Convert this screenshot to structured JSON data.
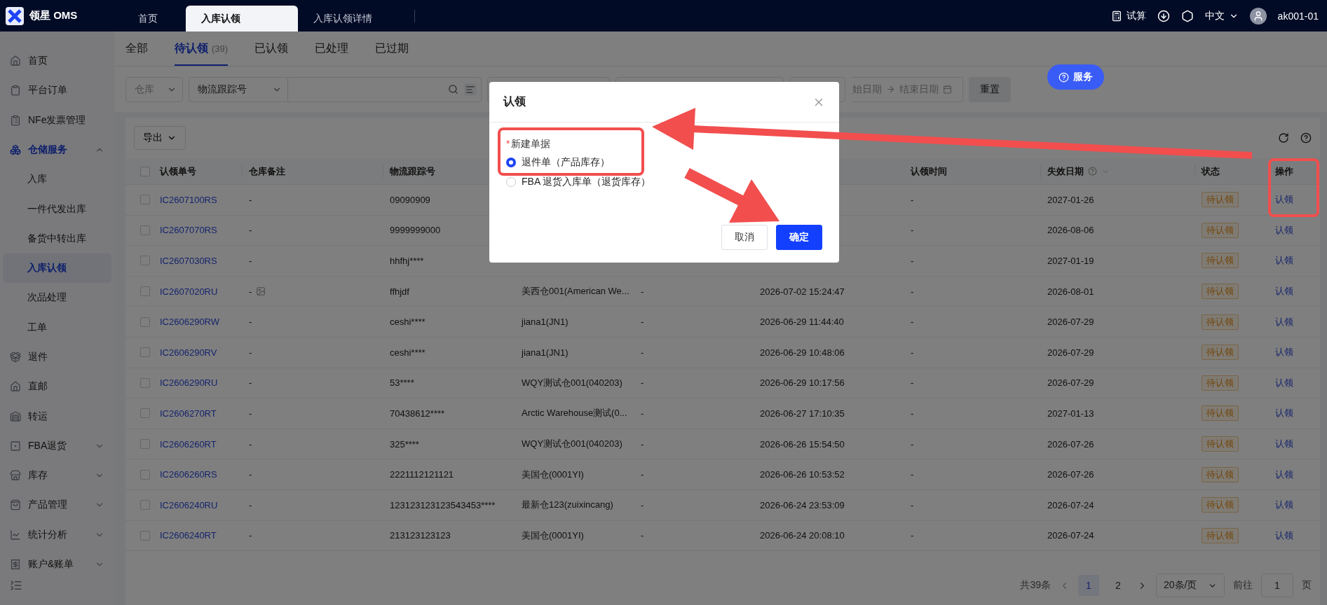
{
  "top_bar": {
    "logo_text": "领星 OMS",
    "tabs": [
      {
        "label": "首页",
        "selected": false
      },
      {
        "label": "入库认领",
        "selected": true
      },
      {
        "label": "入库认领详情",
        "selected": false
      }
    ],
    "trial_calc": "试算",
    "language": "中文",
    "user": "ak001-01"
  },
  "sidebar": {
    "items": [
      {
        "label": "首页",
        "kind": "link",
        "selected": false
      },
      {
        "label": "平台订单",
        "kind": "link",
        "selected": false
      },
      {
        "label": "NFe发票管理",
        "kind": "link",
        "selected": false
      },
      {
        "label": "仓储服务",
        "kind": "group",
        "selected": true,
        "expanded": true,
        "children": [
          {
            "label": "入库",
            "selected": false
          },
          {
            "label": "一件代发出库",
            "selected": false
          },
          {
            "label": "备货中转出库",
            "selected": false
          },
          {
            "label": "入库认领",
            "selected": true
          },
          {
            "label": "次品处理",
            "selected": false
          },
          {
            "label": "工单",
            "selected": false
          }
        ]
      },
      {
        "label": "退件",
        "kind": "link",
        "selected": false
      },
      {
        "label": "直邮",
        "kind": "link",
        "selected": false
      },
      {
        "label": "转运",
        "kind": "link",
        "selected": false
      },
      {
        "label": "FBA退货",
        "kind": "group",
        "selected": false,
        "expanded": false
      },
      {
        "label": "库存",
        "kind": "group",
        "selected": false,
        "expanded": false
      },
      {
        "label": "产品管理",
        "kind": "group",
        "selected": false,
        "expanded": false
      },
      {
        "label": "统计分析",
        "kind": "group",
        "selected": false,
        "expanded": false
      },
      {
        "label": "账户&账单",
        "kind": "group",
        "selected": false,
        "expanded": false
      }
    ]
  },
  "page_tabs": [
    {
      "label": "全部",
      "selected": false
    },
    {
      "label": "待认领",
      "count": "(39)",
      "selected": true
    },
    {
      "label": "已认领",
      "selected": false
    },
    {
      "label": "已处理",
      "selected": false
    },
    {
      "label": "已过期",
      "selected": false
    }
  ],
  "filters": {
    "warehouse_select": "仓库",
    "search_type_select": "物流跟踪号",
    "date_start": "始日期",
    "date_end": "结束日期",
    "reset_button": "重置"
  },
  "service_button": "服务",
  "toolbar": {
    "export_button": "导出"
  },
  "table": {
    "select_all_checked": false,
    "headers": {
      "claim_no": "认领单号",
      "remark": "仓库备注",
      "tracking_no": "物流跟踪号",
      "claim_time": "认领时间",
      "expiry_date": "失效日期",
      "status": "状态",
      "actions": "操作"
    },
    "rows": [
      {
        "checked": false,
        "claim_no": "IC2607100RS",
        "remark": "-",
        "image": false,
        "tracking_no": "09090909",
        "claim_time": "-",
        "expiry_date": "2027-01-26",
        "status": "待认领",
        "action": "认领"
      },
      {
        "checked": false,
        "claim_no": "IC2607070RS",
        "remark": "-",
        "image": false,
        "tracking_no": "9999999000",
        "claim_time": "-",
        "expiry_date": "2026-08-06",
        "status": "待认领",
        "action": "认领"
      },
      {
        "checked": false,
        "claim_no": "IC2607030RS",
        "remark": "-",
        "image": false,
        "tracking_no": "hhfhj****",
        "claim_time": "-",
        "expiry_date": "2027-01-19",
        "status": "待认领",
        "action": "认领"
      },
      {
        "checked": false,
        "claim_no": "IC2607020RU",
        "remark": "-",
        "image": true,
        "tracking_no": "ffhjdf",
        "column_4": "美西仓001(American We...",
        "column_5": "-",
        "column_6": "2026-07-02 15:24:47",
        "claim_time": "-",
        "expiry_date": "2026-08-01",
        "status": "待认领",
        "action": "认领"
      },
      {
        "checked": false,
        "claim_no": "IC2606290RW",
        "remark": "-",
        "image": false,
        "tracking_no": "ceshi****",
        "column_4": "jiana1(JN1)",
        "column_5": "-",
        "column_6": "2026-06-29 11:44:40",
        "claim_time": "-",
        "expiry_date": "2026-07-29",
        "status": "待认领",
        "action": "认领"
      },
      {
        "checked": false,
        "claim_no": "IC2606290RV",
        "remark": "-",
        "image": false,
        "tracking_no": "ceshi****",
        "column_4": "jiana1(JN1)",
        "column_5": "-",
        "column_6": "2026-06-29 10:48:06",
        "claim_time": "-",
        "expiry_date": "2026-07-29",
        "status": "待认领",
        "action": "认领"
      },
      {
        "checked": false,
        "claim_no": "IC2606290RU",
        "remark": "-",
        "image": false,
        "tracking_no": "53****",
        "column_4": "WQY测试仓001(040203)",
        "column_5": "-",
        "column_6": "2026-06-29 10:17:56",
        "claim_time": "-",
        "expiry_date": "2026-07-29",
        "status": "待认领",
        "action": "认领"
      },
      {
        "checked": false,
        "claim_no": "IC2606270RT",
        "remark": "-",
        "image": false,
        "tracking_no": "70438612****",
        "column_4": "Arctic Warehouse测试(0...",
        "column_5": "-",
        "column_6": "2026-06-27 17:10:35",
        "claim_time": "-",
        "expiry_date": "2027-01-13",
        "status": "待认领",
        "action": "认领"
      },
      {
        "checked": false,
        "claim_no": "IC2606260RT",
        "remark": "-",
        "image": false,
        "tracking_no": "325****",
        "column_4": "WQY测试仓001(040203)",
        "column_5": "-",
        "column_6": "2026-06-26 15:54:50",
        "claim_time": "-",
        "expiry_date": "2026-07-26",
        "status": "待认领",
        "action": "认领"
      },
      {
        "checked": false,
        "claim_no": "IC2606260RS",
        "remark": "-",
        "image": false,
        "tracking_no": "2221112121121",
        "column_4": "美国仓(0001YI)",
        "column_5": "-",
        "column_6": "2026-06-26 10:53:52",
        "claim_time": "-",
        "expiry_date": "2026-07-26",
        "status": "待认领",
        "action": "认领"
      },
      {
        "checked": false,
        "claim_no": "IC2606240RU",
        "remark": "-",
        "image": false,
        "tracking_no": "123123123123543453****",
        "column_4": "最新仓123(zuixincang)",
        "column_5": "-",
        "column_6": "2026-06-24 23:53:09",
        "claim_time": "-",
        "expiry_date": "2026-07-24",
        "status": "待认领",
        "action": "认领"
      },
      {
        "checked": false,
        "claim_no": "IC2606240RT",
        "remark": "-",
        "image": false,
        "tracking_no": "213123123123",
        "column_4": "美国仓(0001YI)",
        "column_5": "-",
        "column_6": "2026-06-24 20:08:10",
        "claim_time": "-",
        "expiry_date": "2026-07-24",
        "status": "待认领",
        "action": "认领"
      }
    ]
  },
  "pagination": {
    "total": "共39条",
    "pages": [
      {
        "label": "1",
        "selected": true
      },
      {
        "label": "2",
        "selected": false
      }
    ],
    "page_size": "20条/页",
    "goto_label": "前往",
    "goto_value": "1",
    "page_unit": "页"
  },
  "modal": {
    "title": "认领",
    "required_mark": "*",
    "field_label": "新建单据",
    "options": [
      {
        "label": "退件单（产品库存）",
        "selected": true
      },
      {
        "label": "FBA 退货入库单（退货库存）",
        "selected": false
      }
    ],
    "buttons": [
      {
        "label": "取消",
        "kind": "default"
      },
      {
        "label": "确定",
        "kind": "primary"
      }
    ]
  }
}
